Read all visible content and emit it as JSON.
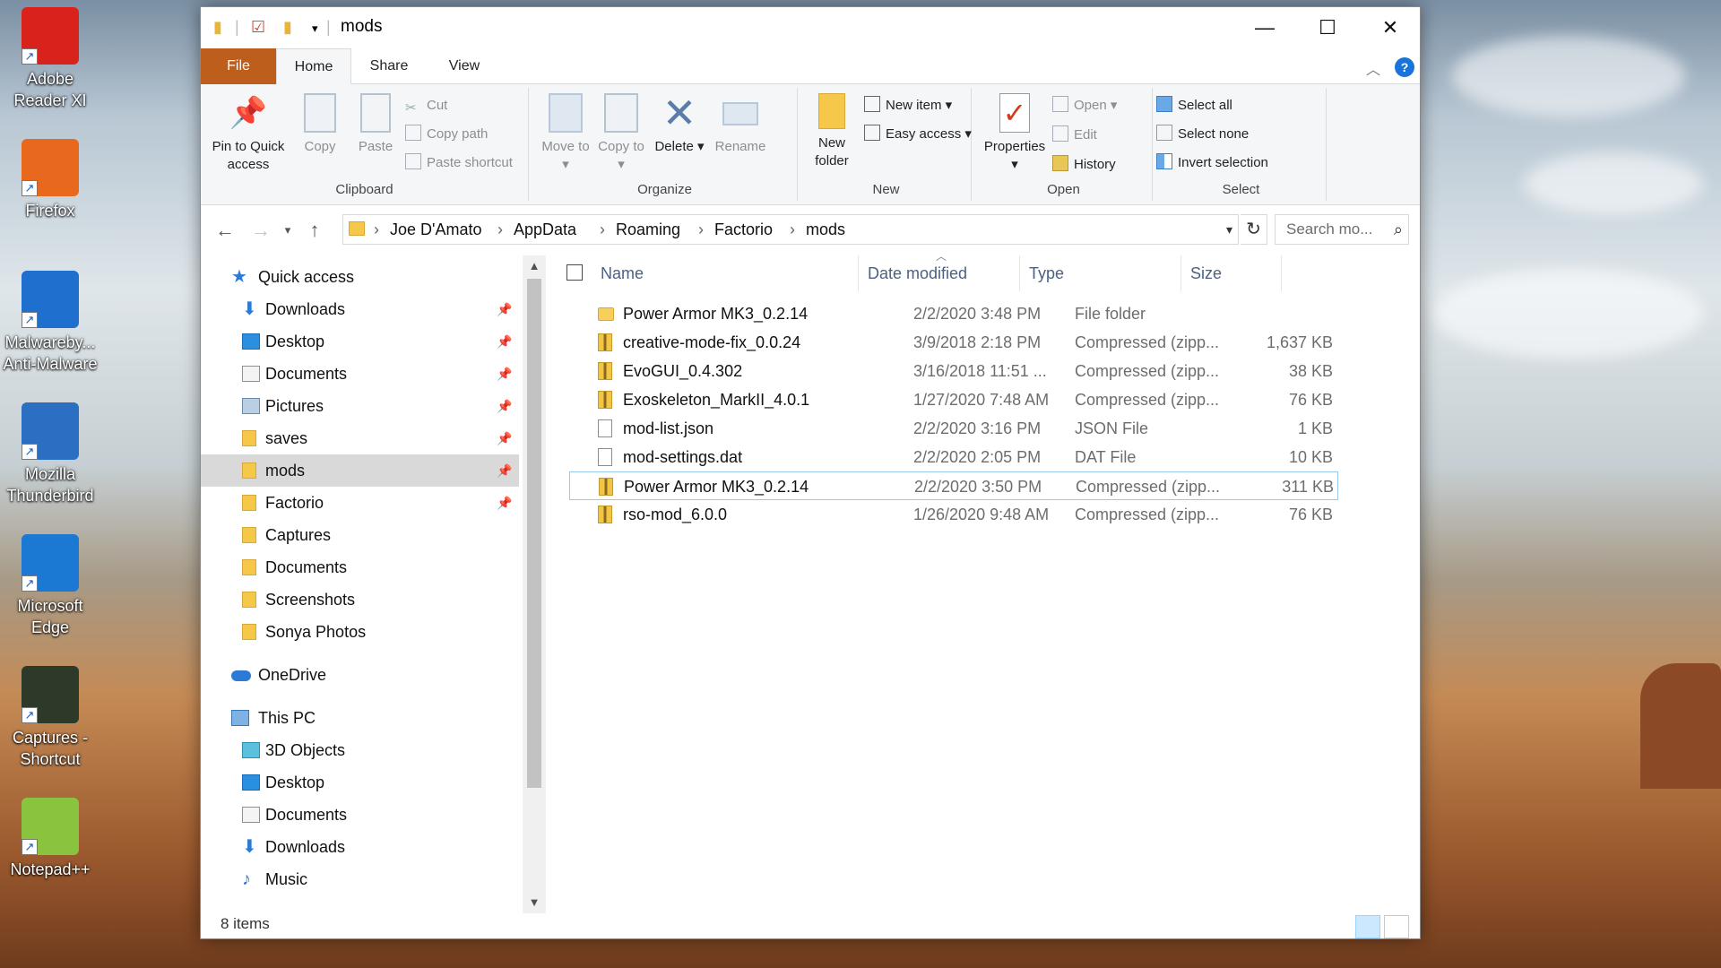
{
  "window": {
    "title": "mods",
    "minimize_glyph": "—",
    "maximize_glyph": "☐",
    "close_glyph": "✕"
  },
  "desktop_icons": [
    {
      "label": "Adobe Reader XI",
      "icon": "adobe-reader-icon",
      "color": "#d8221b"
    },
    {
      "label": "Firefox",
      "icon": "firefox-icon",
      "color": "#e8681e"
    },
    {
      "label": "Malwareby... Anti-Malware",
      "icon": "malwarebytes-icon",
      "color": "#1f6fcf"
    },
    {
      "label": "Mozilla Thunderbird",
      "icon": "thunderbird-icon",
      "color": "#2a6fc2"
    },
    {
      "label": "Microsoft Edge",
      "icon": "edge-icon",
      "color": "#1b78d3"
    },
    {
      "label": "Captures - Shortcut",
      "icon": "folder-shortcut-icon",
      "color": "#2d3a29"
    },
    {
      "label": "Notepad++",
      "icon": "notepadplusplus-icon",
      "color": "#8ac43f"
    }
  ],
  "tabs": {
    "file": "File",
    "home": "Home",
    "share": "Share",
    "view": "View"
  },
  "ribbon": {
    "clipboard": {
      "label": "Clipboard",
      "pin": "Pin to Quick access",
      "copy": "Copy",
      "paste": "Paste",
      "cut": "Cut",
      "copy_path": "Copy path",
      "paste_shortcut": "Paste shortcut"
    },
    "organize": {
      "label": "Organize",
      "move_to": "Move to ▾",
      "copy_to": "Copy to ▾",
      "delete": "Delete ▾",
      "rename": "Rename"
    },
    "new": {
      "label": "New",
      "new_folder": "New folder",
      "new_item": "New item ▾",
      "easy_access": "Easy access ▾"
    },
    "open": {
      "label": "Open",
      "properties": "Properties ▾",
      "open": "Open ▾",
      "edit": "Edit",
      "history": "History"
    },
    "select": {
      "label": "Select",
      "select_all": "Select all",
      "select_none": "Select none",
      "invert": "Invert selection"
    }
  },
  "address": {
    "crumbs": [
      "Joe D'Amato",
      "AppData",
      "Roaming",
      "Factorio",
      "mods"
    ],
    "separator": "›",
    "search_placeholder": "Search mo..."
  },
  "nav": {
    "quick_access": "Quick access",
    "items": [
      {
        "label": "Downloads",
        "icon": "download-arrow-icon",
        "pinned": true
      },
      {
        "label": "Desktop",
        "icon": "desktop-icon",
        "pinned": true
      },
      {
        "label": "Documents",
        "icon": "documents-icon",
        "pinned": true
      },
      {
        "label": "Pictures",
        "icon": "pictures-icon",
        "pinned": true
      },
      {
        "label": "saves",
        "icon": "folder-icon",
        "pinned": true
      },
      {
        "label": "mods",
        "icon": "folder-icon",
        "pinned": true,
        "selected": true
      },
      {
        "label": "Factorio",
        "icon": "folder-icon",
        "pinned": true
      },
      {
        "label": "Captures",
        "icon": "folder-icon",
        "pinned": false
      },
      {
        "label": "Documents",
        "icon": "folder-icon",
        "pinned": false
      },
      {
        "label": "Screenshots",
        "icon": "folder-icon",
        "pinned": false
      },
      {
        "label": "Sonya Photos",
        "icon": "folder-icon",
        "pinned": false
      }
    ],
    "onedrive": "OneDrive",
    "this_pc": "This PC",
    "pc_items": [
      {
        "label": "3D Objects",
        "icon": "3d-objects-icon"
      },
      {
        "label": "Desktop",
        "icon": "desktop-icon"
      },
      {
        "label": "Documents",
        "icon": "documents-icon"
      },
      {
        "label": "Downloads",
        "icon": "download-arrow-icon"
      },
      {
        "label": "Music",
        "icon": "music-icon"
      }
    ]
  },
  "columns": {
    "name": "Name",
    "date": "Date modified",
    "type": "Type",
    "size": "Size"
  },
  "files": [
    {
      "name": "Power Armor MK3_0.2.14",
      "date": "2/2/2020 3:48 PM",
      "type": "File folder",
      "size": "",
      "kind": "folder"
    },
    {
      "name": "creative-mode-fix_0.0.24",
      "date": "3/9/2018 2:18 PM",
      "type": "Compressed (zipp...",
      "size": "1,637 KB",
      "kind": "zip"
    },
    {
      "name": "EvoGUI_0.4.302",
      "date": "3/16/2018 11:51 ...",
      "type": "Compressed (zipp...",
      "size": "38 KB",
      "kind": "zip"
    },
    {
      "name": "Exoskeleton_MarkII_4.0.1",
      "date": "1/27/2020 7:48 AM",
      "type": "Compressed (zipp...",
      "size": "76 KB",
      "kind": "zip"
    },
    {
      "name": "mod-list.json",
      "date": "2/2/2020 3:16 PM",
      "type": "JSON File",
      "size": "1 KB",
      "kind": "doc"
    },
    {
      "name": "mod-settings.dat",
      "date": "2/2/2020 2:05 PM",
      "type": "DAT File",
      "size": "10 KB",
      "kind": "doc"
    },
    {
      "name": "Power Armor MK3_0.2.14",
      "date": "2/2/2020 3:50 PM",
      "type": "Compressed (zipp...",
      "size": "311 KB",
      "kind": "zip",
      "focused": true
    },
    {
      "name": "rso-mod_6.0.0",
      "date": "1/26/2020 9:48 AM",
      "type": "Compressed (zipp...",
      "size": "76 KB",
      "kind": "zip"
    }
  ],
  "status": {
    "item_count": "8 items"
  }
}
